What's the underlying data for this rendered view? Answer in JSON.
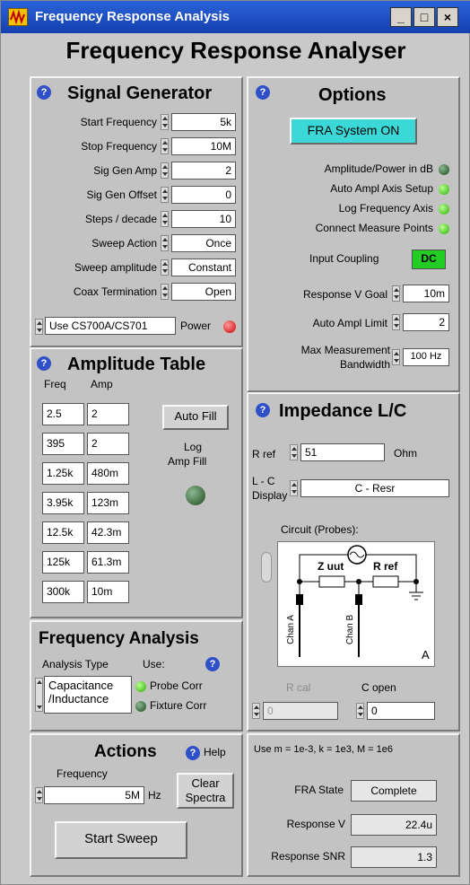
{
  "window": {
    "title": "Frequency Response Analysis",
    "app_title": "Frequency Response Analyser"
  },
  "signal_generator": {
    "title": "Signal Generator",
    "rows": [
      {
        "label": "Start Frequency",
        "value": "5k"
      },
      {
        "label": "Stop Frequency",
        "value": "10M"
      },
      {
        "label": "Sig Gen Amp",
        "value": "2"
      },
      {
        "label": "Sig Gen Offset",
        "value": "0"
      },
      {
        "label": "Steps / decade",
        "value": "10"
      },
      {
        "label": "Sweep Action",
        "value": "Once"
      },
      {
        "label": "Sweep amplitude",
        "value": "Constant"
      },
      {
        "label": "Coax Termination",
        "value": "Open"
      }
    ],
    "device": "Use CS700A/CS701",
    "power_label": "Power"
  },
  "options": {
    "title": "Options",
    "fra_button": "FRA System ON",
    "indicators": [
      {
        "label": "Amplitude/Power in dB",
        "state": "off"
      },
      {
        "label": "Auto Ampl Axis Setup",
        "state": "on"
      },
      {
        "label": "Log Frequency Axis",
        "state": "on"
      },
      {
        "label": "Connect Measure Points",
        "state": "on"
      }
    ],
    "coupling_label": "Input Coupling",
    "coupling_value": "DC",
    "response_goal_label": "Response V Goal",
    "response_goal": "10m",
    "auto_limit_label": "Auto Ampl Limit",
    "auto_limit": "2",
    "max_bw_label1": "Max Measurement",
    "max_bw_label2": "Bandwidth",
    "max_bw": "100 Hz"
  },
  "amplitude_table": {
    "title": "Amplitude Table",
    "col_freq": "Freq",
    "col_amp": "Amp",
    "rows": [
      [
        "2.5",
        "2"
      ],
      [
        "395",
        "2"
      ],
      [
        "1.25k",
        "480m"
      ],
      [
        "3.95k",
        "123m"
      ],
      [
        "12.5k",
        "42.3m"
      ],
      [
        "125k",
        "61.3m"
      ],
      [
        "300k",
        "10m"
      ]
    ],
    "auto_fill": "Auto Fill",
    "log_amp_fill1": "Log",
    "log_amp_fill2": "Amp Fill"
  },
  "impedance": {
    "title": "Impedance L/C",
    "rref_label": "R ref",
    "rref_value": "51",
    "rref_unit": "Ohm",
    "lc_label1": "L - C",
    "lc_label2": "Display",
    "lc_value": "C  -  Resr",
    "circuit_label": "Circuit (Probes):",
    "zuut": "Z uut",
    "rref": "R ref",
    "chan_a": "Chan A",
    "chan_b": "Chan B",
    "circuit_id": "A",
    "rcal_label": "R cal",
    "rcal_value": "0",
    "copen_label": "C open",
    "copen_value": "0"
  },
  "freq_analysis": {
    "title": "Frequency Analysis",
    "type_label": "Analysis Type",
    "use_label": "Use:",
    "type_value1": "Capacitance",
    "type_value2": "/Inductance",
    "probe_corr": "Probe Corr",
    "fixture_corr": "Fixture Corr"
  },
  "actions": {
    "title": "Actions",
    "help": "Help",
    "freq_label": "Frequency",
    "freq_value": "5M",
    "freq_unit": "Hz",
    "clear1": "Clear",
    "clear2": "Spectra",
    "start": "Start Sweep"
  },
  "status": {
    "units_note": "Use m = 1e-3, k = 1e3, M = 1e6",
    "fra_state_label": "FRA State",
    "fra_state": "Complete",
    "response_v_label": "Response V",
    "response_v": "22.4u",
    "snr_label": "Response SNR",
    "snr": "1.3"
  }
}
